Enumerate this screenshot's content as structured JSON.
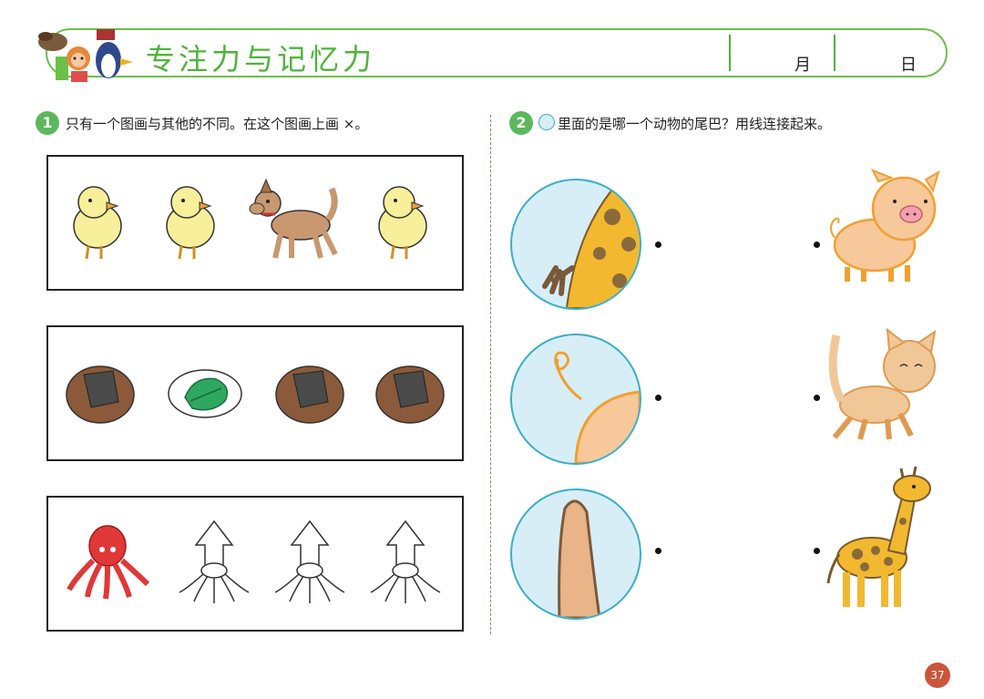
{
  "header": {
    "title": "专注力与记忆力",
    "month_label": "月",
    "day_label": "日"
  },
  "question1": {
    "number": "1",
    "instruction": "只有一个图画与其他的不同。在这个图画上画 ×。",
    "rows": [
      {
        "items": [
          "chick",
          "chick",
          "dog",
          "chick"
        ]
      },
      {
        "items": [
          "rice-ball",
          "leaf-plate",
          "rice-ball",
          "rice-ball"
        ]
      },
      {
        "items": [
          "octopus",
          "squid",
          "squid",
          "squid"
        ]
      }
    ]
  },
  "question2": {
    "number": "2",
    "instruction": "里面的是哪一个动物的尾巴？用线连接起来。",
    "tails": [
      "giraffe-tail",
      "pig-tail",
      "cat-tail"
    ],
    "animals": [
      "pig",
      "cat",
      "giraffe"
    ]
  },
  "page_number": "37",
  "colors": {
    "accent_green": "#4fb33a",
    "circle_blue": "#d7eef7",
    "page_badge": "#c9553a"
  }
}
